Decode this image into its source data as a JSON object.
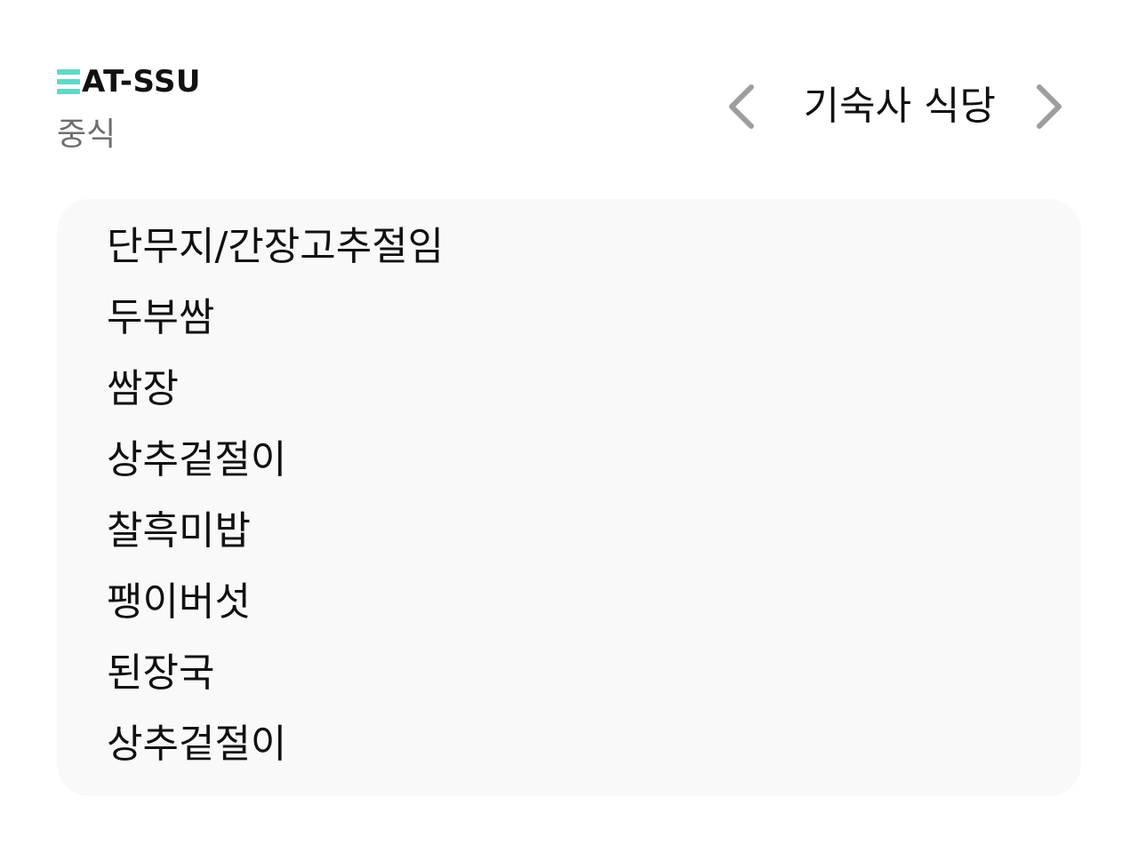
{
  "header": {
    "logo_text": "AT-SSU",
    "logo_full_name": "EAT-SSU",
    "accent_color": "#5fd9c7",
    "meal_type": "중식"
  },
  "nav": {
    "title": "기숙사 식당",
    "prev_icon": "chevron-left-icon",
    "next_icon": "chevron-right-icon",
    "arrow_color": "#9e9e9e"
  },
  "menu": {
    "items": [
      "단무지/간장고추절임",
      "두부쌈",
      "쌈장",
      "상추겉절이",
      "찰흑미밥",
      "팽이버섯",
      "된장국",
      "상추겉절이"
    ]
  }
}
